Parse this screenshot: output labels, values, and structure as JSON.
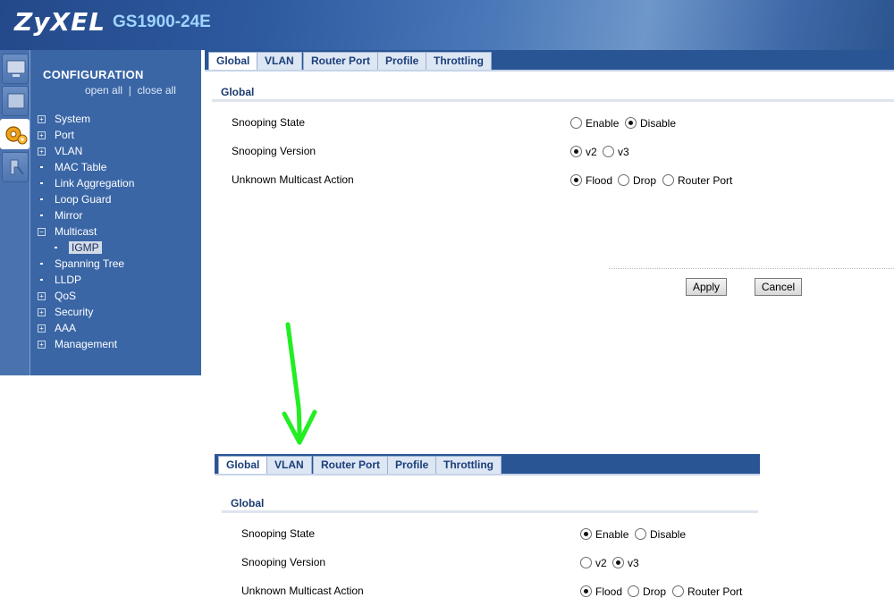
{
  "header": {
    "logo": "ZyXEL",
    "model": "GS1900-24E"
  },
  "sidebar": {
    "title": "CONFIGURATION",
    "open_all": "open all",
    "separator": "|",
    "close_all": "close all",
    "items": [
      {
        "label": "System",
        "marker": "+"
      },
      {
        "label": "Port",
        "marker": "+"
      },
      {
        "label": "VLAN",
        "marker": "+"
      },
      {
        "label": "MAC Table",
        "marker": "•"
      },
      {
        "label": "Link Aggregation",
        "marker": "•"
      },
      {
        "label": "Loop Guard",
        "marker": "•"
      },
      {
        "label": "Mirror",
        "marker": "•"
      },
      {
        "label": "Multicast",
        "marker": "−"
      },
      {
        "label": "IGMP",
        "marker": "•",
        "selected": true
      },
      {
        "label": "Spanning Tree",
        "marker": "•"
      },
      {
        "label": "LLDP",
        "marker": "•"
      },
      {
        "label": "QoS",
        "marker": "+"
      },
      {
        "label": "Security",
        "marker": "+"
      },
      {
        "label": "AAA",
        "marker": "+"
      },
      {
        "label": "Management",
        "marker": "+"
      }
    ]
  },
  "tabs": [
    "Global",
    "VLAN",
    "Router Port",
    "Profile",
    "Throttling"
  ],
  "section_title": "Global",
  "form_labels": {
    "snooping_state": "Snooping State",
    "snooping_version": "Snooping Version",
    "unknown_multicast_action": "Unknown Multicast Action"
  },
  "options": {
    "enable": "Enable",
    "disable": "Disable",
    "v2": "v2",
    "v3": "v3",
    "flood": "Flood",
    "drop": "Drop",
    "router_port": "Router Port"
  },
  "before": {
    "snooping_state": "Disable",
    "snooping_version": "v2",
    "unknown_multicast_action": "Flood"
  },
  "after": {
    "snooping_state": "Enable",
    "snooping_version": "v3",
    "unknown_multicast_action": "Flood"
  },
  "buttons": {
    "apply": "Apply",
    "cancel": "Cancel"
  },
  "colors": {
    "arrow": "#22ee22",
    "header_blue": "#2e5aa0",
    "model_text": "#9fd4ff",
    "tab_text": "#1a3e7a"
  }
}
